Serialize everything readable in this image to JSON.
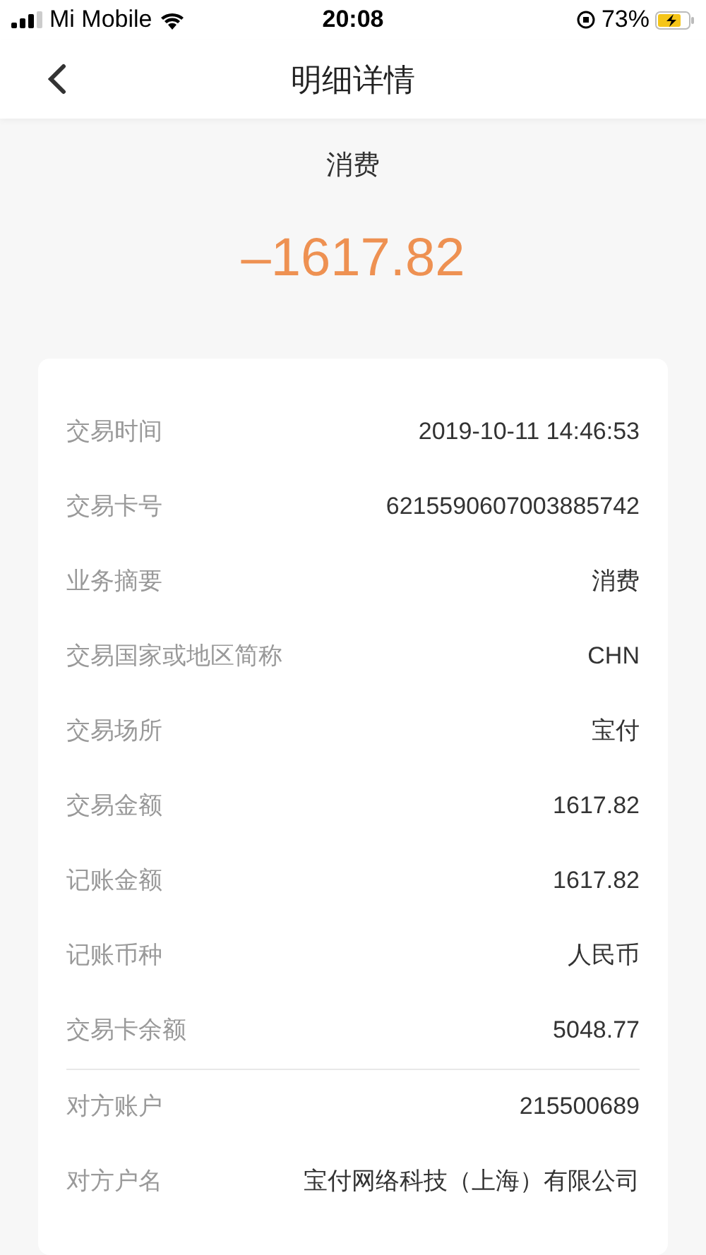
{
  "status_bar": {
    "carrier": "Mi Mobile",
    "time": "20:08",
    "battery": "73%"
  },
  "header": {
    "title": "明细详情"
  },
  "summary": {
    "type": "消费",
    "amount": "–1617.82"
  },
  "sections": [
    {
      "rows": [
        {
          "label": "交易时间",
          "value": "2019-10-11 14:46:53"
        },
        {
          "label": "交易卡号",
          "value": "6215590607003885742"
        },
        {
          "label": "业务摘要",
          "value": "消费"
        },
        {
          "label": "交易国家或地区简称",
          "value": "CHN"
        },
        {
          "label": "交易场所",
          "value": "宝付"
        },
        {
          "label": "交易金额",
          "value": "1617.82"
        },
        {
          "label": "记账金额",
          "value": "1617.82"
        },
        {
          "label": "记账币种",
          "value": "人民币"
        },
        {
          "label": "交易卡余额",
          "value": "5048.77"
        }
      ]
    },
    {
      "rows": [
        {
          "label": "对方账户",
          "value": "215500689"
        },
        {
          "label": "对方户名",
          "value": "宝付网络科技（上海）有限公司"
        }
      ]
    }
  ]
}
